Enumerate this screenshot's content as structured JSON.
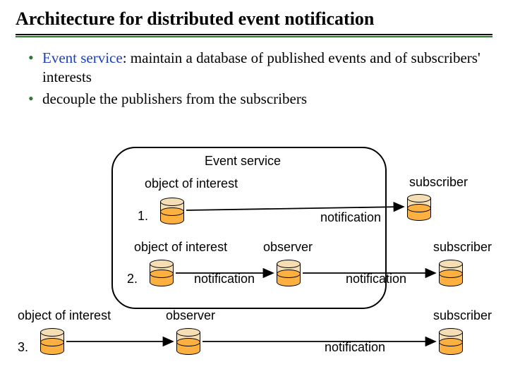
{
  "title": "Architecture for distributed event notification",
  "bullets": [
    {
      "term": "Event service",
      "rest": ":  maintain a database of published events and of subscribers' interests"
    },
    {
      "term": "",
      "rest": "decouple the publishers from the subscribers"
    }
  ],
  "labels": {
    "event_service": "Event service",
    "object_of_interest": "object of interest",
    "subscriber": "subscriber",
    "observer": "observer",
    "notification": "notification",
    "row1": "1.",
    "row2": "2.",
    "row3": "3."
  }
}
